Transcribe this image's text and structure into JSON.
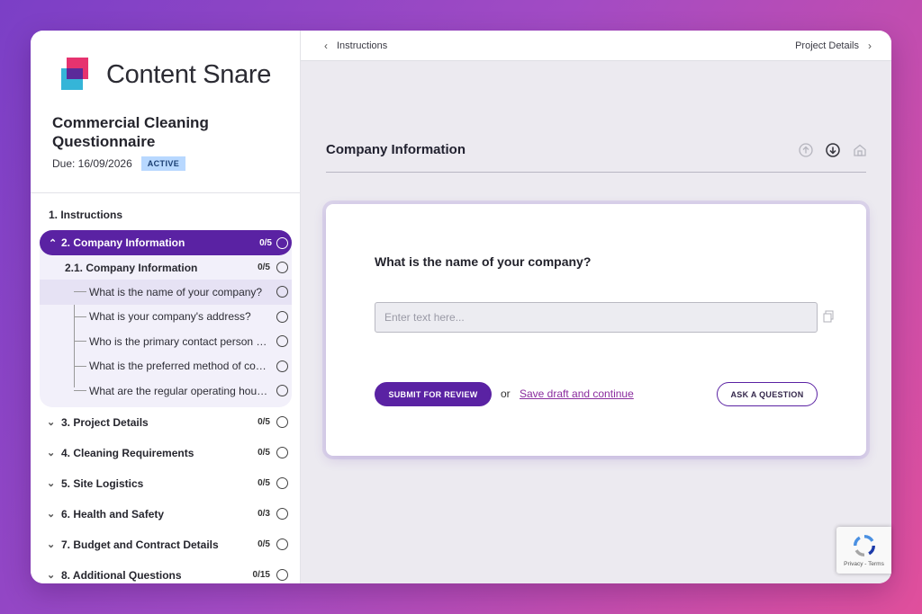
{
  "brand": {
    "name": "Content Snare"
  },
  "questionnaire": {
    "title": "Commercial Cleaning Questionnaire",
    "due": "Due: 16/09/2026",
    "status": "ACTIVE"
  },
  "nav": {
    "instructions": "1. Instructions",
    "active_section": {
      "label": "2. Company Information",
      "count": "0/5"
    },
    "subsection": {
      "label": "2.1. Company Information",
      "count": "0/5"
    },
    "questions": [
      "What is the name of your company?",
      "What is your company's address?",
      "Who is the primary contact person for this project?",
      "What is the preferred method of communication?",
      "What are the regular operating hours?"
    ],
    "sections": [
      {
        "label": "3. Project Details",
        "count": "0/5"
      },
      {
        "label": "4. Cleaning Requirements",
        "count": "0/5"
      },
      {
        "label": "5. Site Logistics",
        "count": "0/5"
      },
      {
        "label": "6. Health and Safety",
        "count": "0/3"
      },
      {
        "label": "7. Budget and Contract Details",
        "count": "0/5"
      },
      {
        "label": "8. Additional Questions",
        "count": "0/15"
      }
    ]
  },
  "topbar": {
    "prev": "Instructions",
    "next": "Project Details"
  },
  "main": {
    "section_title": "Company Information",
    "question": "What is the name of your company?",
    "input_placeholder": "Enter text here...",
    "submit_label": "SUBMIT FOR REVIEW",
    "or_text": "or",
    "draft_link": "Save draft and continue",
    "ask_label": "ASK A QUESTION"
  },
  "recaptcha": {
    "text": "Privacy - Terms"
  },
  "colors": {
    "accent": "#5a22a3",
    "badge_bg": "#b8d8ff",
    "link": "#8a2c9e"
  }
}
